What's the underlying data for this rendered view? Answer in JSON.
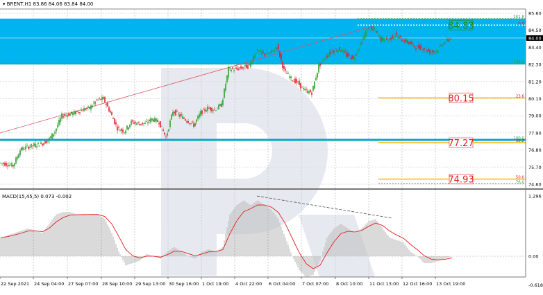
{
  "header": {
    "symbol_info": "BRENT,H1  83.86 84.06 83.84 84.00"
  },
  "macd_header": "MACD(15,45,5) 0.073 -0.002",
  "colors": {
    "zone": "#00b4f0",
    "bull": "#2e9e2e",
    "bear": "#e0202a",
    "fibo": "#f5b800",
    "trend": "#e05060",
    "macd_hist": "#c0c0c0",
    "macd_signal": "#e02020"
  },
  "chart_data": [
    {
      "type": "candlestick",
      "title": "BRENT,H1",
      "ylim": [
        74.6,
        85.6
      ],
      "y_ticks": [
        "85.60",
        "84.50",
        "83.40",
        "82.30",
        "81.20",
        "80.10",
        "79.00",
        "77.90",
        "76.80",
        "75.70",
        "74.60"
      ],
      "current_price": "84.00",
      "x_ticks": [
        "22 Sep 2021",
        "24 Sep 04:00",
        "27 Sep 07:00",
        "28 Sep 10:00",
        "29 Sep 13:00",
        "30 Sep 16:00",
        "1 Oct 19:00",
        "4 Oct 22:00",
        "6 Oct 04:00",
        "7 Oct 07:00",
        "8 Oct 10:00",
        "11 Oct 13:00",
        "12 Oct 16:00",
        "13 Oct 19:00"
      ],
      "closes": [
        75.98,
        75.9,
        75.8,
        76.8,
        77.0,
        77.1,
        77.2,
        77.4,
        78.0,
        79.0,
        79.1,
        79.2,
        79.4,
        79.5,
        80.0,
        80.1,
        79.2,
        78.2,
        78.0,
        78.6,
        78.5,
        78.5,
        78.8,
        78.6,
        77.6,
        79.3,
        79.0,
        78.7,
        78.4,
        79.2,
        79.5,
        79.4,
        79.7,
        82.0,
        82.0,
        82.1,
        82.2,
        83.2,
        83.0,
        83.0,
        83.5,
        81.9,
        81.4,
        81.1,
        80.6,
        80.5,
        82.2,
        82.8,
        83.2,
        83.3,
        82.9,
        82.7,
        83.6,
        84.6,
        84.5,
        83.9,
        83.9,
        84.2,
        83.9,
        83.7,
        83.4,
        83.4,
        83.1,
        83.2,
        83.7,
        84.0
      ],
      "target_zone": [
        82.3,
        85.25
      ],
      "fibo_levels": [
        {
          "label": "161.8",
          "price": 85.25,
          "color": "#3a9a3a"
        },
        {
          "label": "0.0",
          "price": 84.83,
          "color": "#e02020"
        },
        {
          "label": "138.2",
          "price": 82.35,
          "color": "#3a9a3a"
        },
        {
          "label": "23.6",
          "price": 80.15,
          "color": "#e02020"
        },
        {
          "label": "100.0",
          "price": 77.45,
          "color": "#3a9a3a"
        },
        {
          "label": "38.2",
          "price": 77.27,
          "color": "#e02020"
        },
        {
          "label": "50.0",
          "price": 74.93,
          "color": "#e02020"
        },
        {
          "label": "76.0",
          "price": 74.62,
          "color": "#3a9a3a"
        }
      ],
      "price_boxes": [
        {
          "text": "84.83",
          "color": "#1a8a1a"
        },
        {
          "text": "80.15",
          "color": "#e02020"
        },
        {
          "text": "77.27",
          "color": "#e02020"
        },
        {
          "text": "74.93",
          "color": "#e02020"
        }
      ]
    },
    {
      "type": "bar",
      "title": "MACD(15,45,5)",
      "ylim": [
        -0.618,
        1.296
      ],
      "y_ticks": [
        "1.296",
        "0.00",
        "-0.618"
      ],
      "values": [
        0.4,
        0.45,
        0.5,
        0.55,
        0.6,
        0.55,
        0.5,
        0.7,
        0.9,
        0.95,
        0.95,
        0.9,
        0.9,
        0.9,
        0.9,
        0.8,
        0.5,
        0.1,
        -0.2,
        -0.15,
        -0.1,
        0.05,
        0.0,
        -0.05,
        0.1,
        0.2,
        0.1,
        0.0,
        -0.05,
        0.1,
        0.15,
        0.1,
        0.2,
        0.9,
        1.1,
        1.2,
        1.1,
        1.2,
        1.1,
        1.0,
        0.8,
        0.4,
        0.0,
        -0.3,
        -0.45,
        -0.4,
        -0.1,
        0.4,
        0.6,
        0.7,
        0.6,
        0.5,
        0.6,
        0.75,
        0.8,
        0.6,
        0.4,
        0.35,
        0.3,
        0.1,
        0.0,
        -0.15,
        -0.15,
        -0.1,
        -0.05,
        0.0
      ]
    }
  ]
}
